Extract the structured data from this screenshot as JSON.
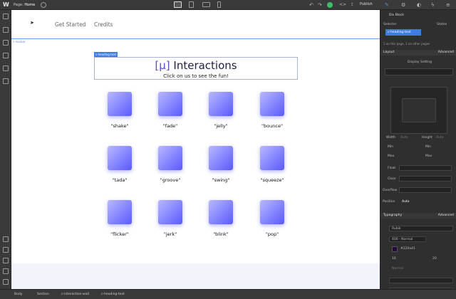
{
  "topbar": {
    "logo": "W",
    "page_label": "Page:",
    "page_name": "Home",
    "publish": "Publish"
  },
  "nav": {
    "links": [
      "Get Started",
      "Credits"
    ]
  },
  "canvas": {
    "navbar_tag": "c-navbar",
    "heading_tag": "c-heading-text"
  },
  "hero": {
    "bracket": "[μ]",
    "title": "Interactions",
    "subtitle": "Click on us to see the fun!"
  },
  "tiles": [
    "\"shake\"",
    "\"fade\"",
    "\"jelly\"",
    "\"bounce\"",
    "\"tada\"",
    "\"groove\"",
    "\"swing\"",
    "\"squeeze\"",
    "\"flicker\"",
    "\"jerk\"",
    "\"blink\"",
    "\"pop\""
  ],
  "breadcrumbs": [
    "Body",
    "Section",
    "c-interaction-wall",
    "c-heading-text"
  ],
  "panel": {
    "div_block": "Div Block",
    "selector_label": "Selector",
    "states_label": "States",
    "selector_chip": "c-heading-text",
    "on_page": "1 on this page, 1 on other pages",
    "layout": "Layout",
    "advanced": "Advanced",
    "display_setting": "Display Setting",
    "width": "Width",
    "height": "Height",
    "auto": "Auto",
    "min": "Min",
    "max": "Max",
    "float": "Float",
    "clear": "Clear",
    "overflow": "Overflow",
    "position": "Position",
    "position_value": "Auto",
    "typography": "Typography",
    "font": "Rubik",
    "weight": "400 - Normal",
    "color": "#220a41",
    "font_size": "16",
    "line_height": "20",
    "style": "Normal"
  },
  "colors": {
    "accent": "#3d7de0",
    "tile_start": "#b8b8ff",
    "tile_end": "#5a5aff",
    "heading": "#222244",
    "text_color_swatch": "#220a41"
  }
}
